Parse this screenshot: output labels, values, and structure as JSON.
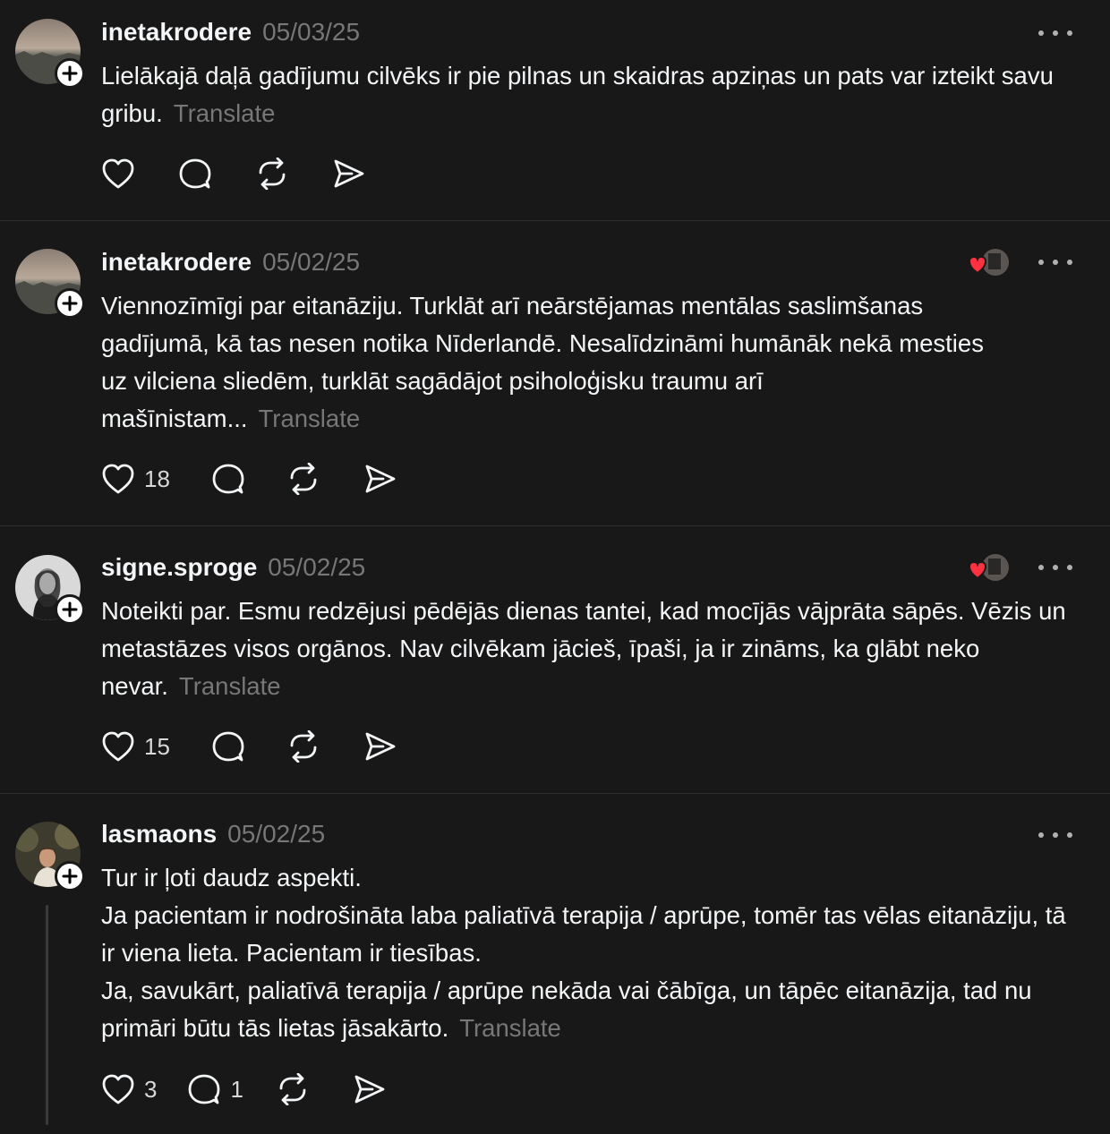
{
  "posts": [
    {
      "username": "inetakrodere",
      "date": "05/03/25",
      "text": "Lielākajā daļā gadījumu cilvēks ir pie pilnas un skaidras apziņas un pats var izteikt savu gribu.",
      "translate_label": "Translate",
      "likes": "",
      "replies": ""
    },
    {
      "username": "inetakrodere",
      "date": "05/02/25",
      "text": "Viennozīmīgi par eitanāziju. Turklāt arī neārstējamas mentālas saslimšanas gadījumā, kā tas nesen notika Nīderlandē. Nesalīdzināmi humānāk nekā mesties uz vilciena sliedēm, turklāt sagādājot psiholoģisku traumu arī mašīnistam...",
      "translate_label": "Translate",
      "likes": "18",
      "replies": ""
    },
    {
      "username": "signe.sproge",
      "date": "05/02/25",
      "text": "Noteikti par. Esmu redzējusi pēdējās dienas tantei, kad mocījās vājprāta sāpēs. Vēzis un metastāzes visos orgānos. Nav cilvēkam jācieš, īpaši, ja ir zināms, ka glābt neko nevar.",
      "translate_label": "Translate",
      "likes": "15",
      "replies": ""
    },
    {
      "username": "lasmaons",
      "date": "05/02/25",
      "lines": [
        "Tur ir ļoti daudz aspekti.",
        "Ja pacientam ir nodrošināta laba paliatīvā terapija / aprūpe, tomēr tas vēlas eitanāziju, tā ir viena lieta. Pacientam ir tiesības.",
        "Ja, savukārt, paliatīvā terapija / aprūpe nekāda vai čābīga, un tāpēc eitanāzija, tad nu primāri būtu tās lietas jāsakārto."
      ],
      "translate_label": "Translate",
      "likes": "3",
      "replies": "1"
    }
  ],
  "icons": [
    "heart-icon",
    "comment-icon",
    "repost-icon",
    "share-icon",
    "more-icon",
    "follow-plus-icon"
  ],
  "colors": {
    "background": "#181818",
    "text": "#f3f5f7",
    "muted": "#777777",
    "like_red": "#ff3040"
  }
}
